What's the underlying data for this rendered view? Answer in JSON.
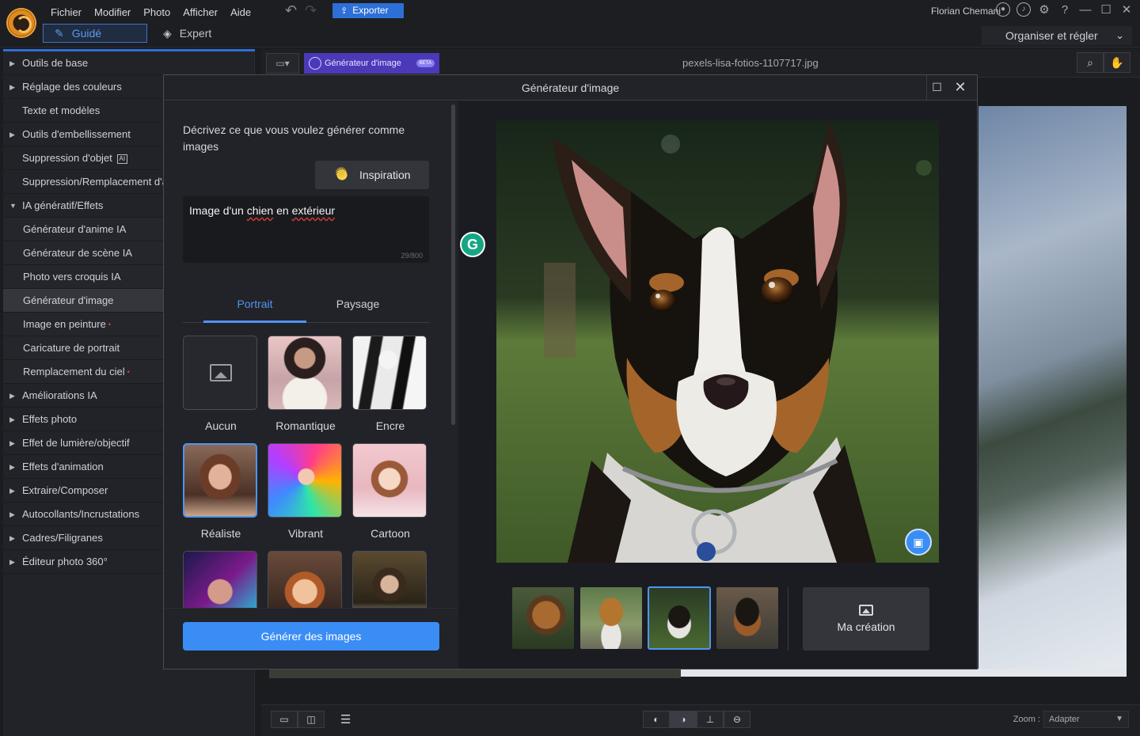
{
  "menu": [
    "Fichier",
    "Modifier",
    "Photo",
    "Afficher",
    "Aide"
  ],
  "toolbar": {
    "undo": "↶",
    "redo": "↷",
    "export_label": "Exporter"
  },
  "user": {
    "name": "Florian Chemani"
  },
  "modes": {
    "guide": "Guidé",
    "expert": "Expert"
  },
  "organiser": {
    "label": "Organiser et régler"
  },
  "sidebar": {
    "items": [
      {
        "label": "Outils de base",
        "type": "group"
      },
      {
        "label": "Réglage des couleurs",
        "type": "group"
      },
      {
        "label": "Texte et modèles",
        "type": "item"
      },
      {
        "label": "Outils d'embellissement",
        "type": "group"
      },
      {
        "label": "Suppression d'objet",
        "type": "item-badge"
      },
      {
        "label": "Suppression/Remplacement d'arrière-plan",
        "type": "item"
      },
      {
        "label": "IA génératif/Effets",
        "type": "open"
      },
      {
        "label": "Générateur d'anime IA",
        "type": "sub"
      },
      {
        "label": "Générateur de scène IA",
        "type": "sub"
      },
      {
        "label": "Photo vers croquis IA",
        "type": "sub"
      },
      {
        "label": "Générateur d'image",
        "type": "sub-sel"
      },
      {
        "label": "Image en peinture",
        "type": "sub-new"
      },
      {
        "label": "Caricature de portrait",
        "type": "sub"
      },
      {
        "label": "Remplacement du ciel",
        "type": "sub-new"
      },
      {
        "label": "Améliorations IA",
        "type": "group"
      },
      {
        "label": "Effets photo",
        "type": "group"
      },
      {
        "label": "Effet de lumière/objectif",
        "type": "group"
      },
      {
        "label": "Effets d'animation",
        "type": "group"
      },
      {
        "label": "Extraire/Composer",
        "type": "group"
      },
      {
        "label": "Autocollants/Incrustations",
        "type": "group"
      },
      {
        "label": "Cadres/Filigranes",
        "type": "group"
      },
      {
        "label": "Éditeur photo 360°",
        "type": "group"
      }
    ]
  },
  "canvas": {
    "tab_label": "Générateur d'image",
    "beta": "BETA",
    "filename": "pexels-lisa-fotios-1107717.jpg"
  },
  "dialog": {
    "title": "Générateur d'image",
    "description": "Décrivez ce que vous voulez générer comme images",
    "inspiration_label": "Inspiration",
    "prompt_text_pre": "Image d'un ",
    "prompt_word1": "chien",
    "prompt_mid": " en ",
    "prompt_word2": "extérieur",
    "char_count": "29/800",
    "tabs": {
      "portrait": "Portrait",
      "paysage": "Paysage"
    },
    "styles": [
      "Aucun",
      "Romantique",
      "Encre",
      "Réaliste",
      "Vibrant",
      "Cartoon"
    ],
    "selected_style": "Réaliste",
    "generate_label": "Générer des images",
    "my_creation_label": "Ma création",
    "selected_thumbnail": 3
  },
  "bottombar": {
    "zoom_label": "Zoom :",
    "zoom_value": "Adapter"
  },
  "colors": {
    "accent": "#3a8df5",
    "beta_purple": "#4a3ab8",
    "grammarly": "#15a684"
  }
}
